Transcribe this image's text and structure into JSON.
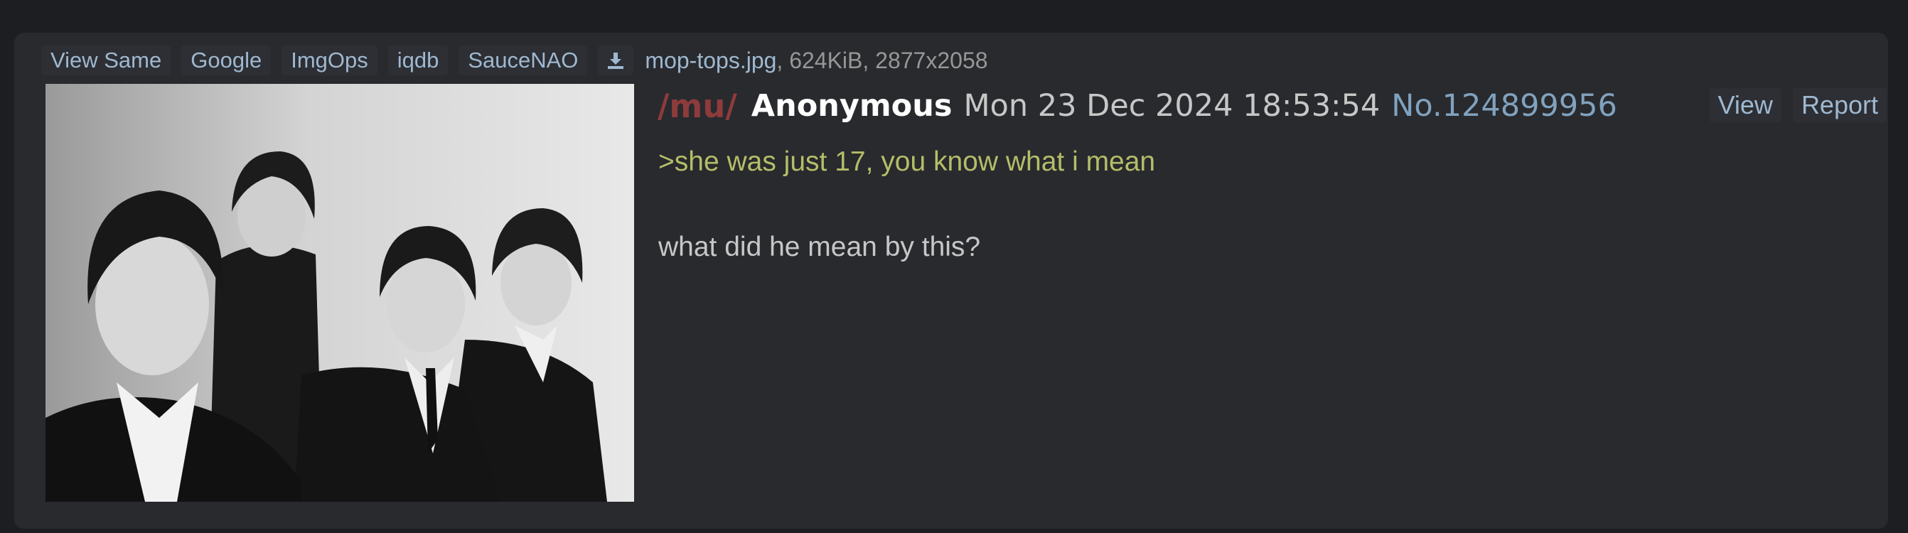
{
  "file_bar": {
    "buttons": [
      "View Same",
      "Google",
      "ImgOps",
      "iqdb",
      "SauceNAO"
    ],
    "download_icon": "download-icon",
    "filename": "mop-tops.jpg",
    "meta": ", 624KiB, 2877x2058"
  },
  "thumbnail": {
    "description_icon": "black-and-white-photo"
  },
  "post": {
    "board": "/mu/",
    "name": "Anonymous",
    "datetime": "Mon 23 Dec 2024 18:53:54",
    "number": "No.124899956",
    "actions": [
      "View",
      "Report"
    ],
    "greentext": ">she was just 17, you know what i mean",
    "body": "what did he mean by this?"
  },
  "colors": {
    "background": "#1d1e22",
    "panel": "#282a2e",
    "link": "#9fb8d0",
    "board": "#8e3b3b",
    "greentext": "#b5bd68",
    "text": "#c5c8c6"
  }
}
